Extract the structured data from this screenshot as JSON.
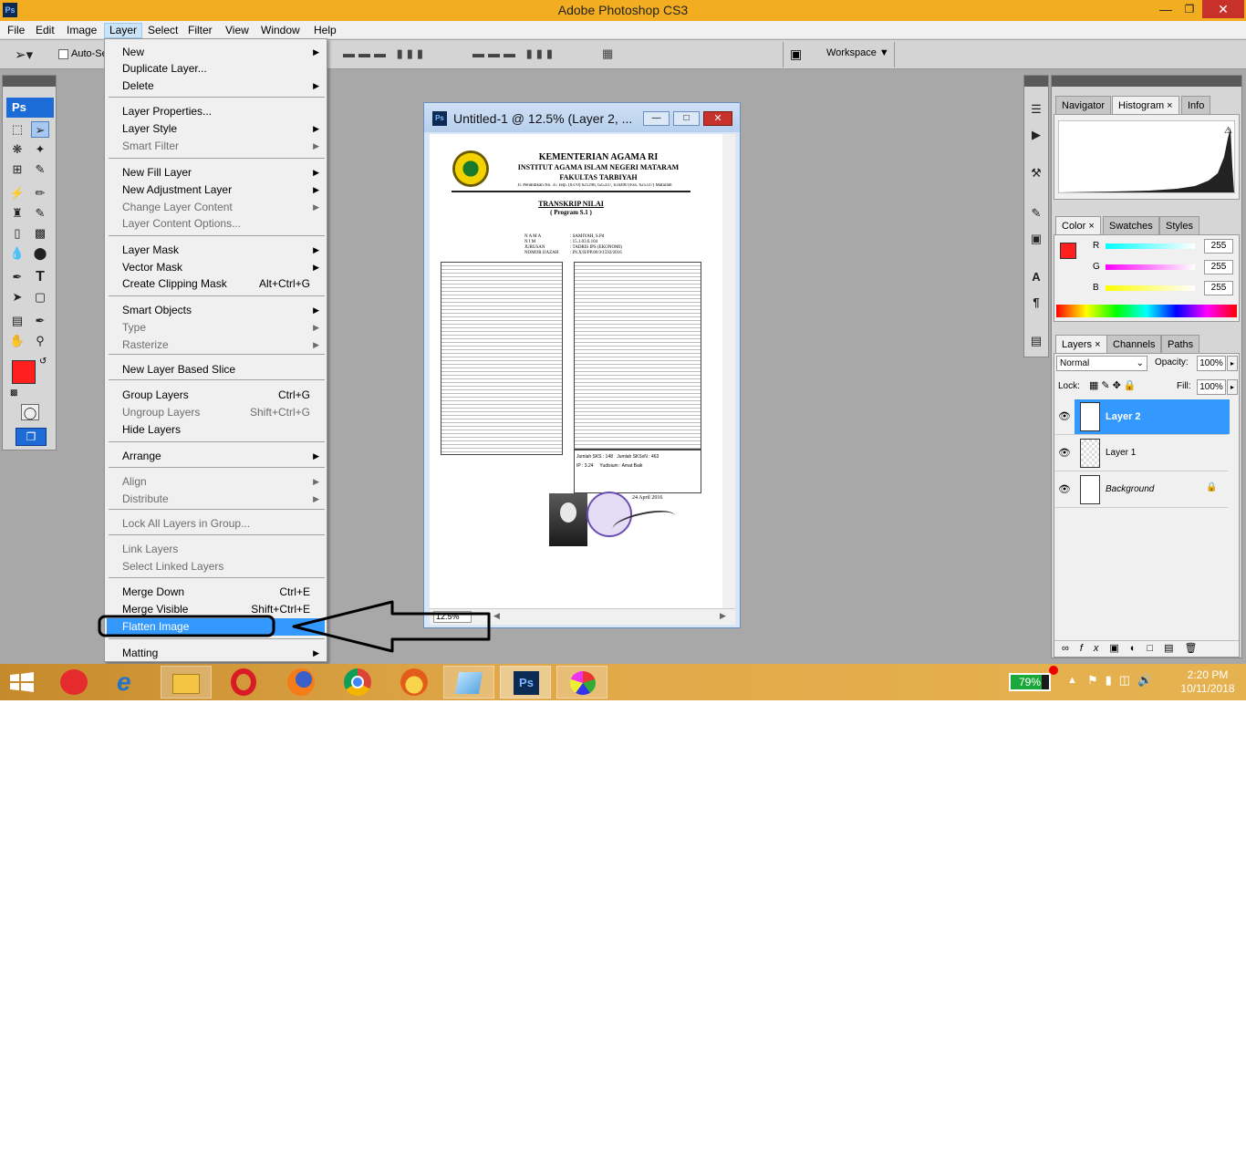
{
  "app": {
    "title": "Adobe Photoshop CS3"
  },
  "menubar": [
    "File",
    "Edit",
    "Image",
    "Layer",
    "Select",
    "Filter",
    "View",
    "Window",
    "Help"
  ],
  "options": {
    "auto_select": "Auto-Se",
    "workspace": "Workspace"
  },
  "layer_menu": [
    {
      "label": "New",
      "arrow": true
    },
    {
      "label": "Duplicate Layer..."
    },
    {
      "label": "Delete",
      "arrow": true
    },
    {
      "sep": true
    },
    {
      "label": "Layer Properties..."
    },
    {
      "label": "Layer Style",
      "arrow": true
    },
    {
      "label": "Smart Filter",
      "arrow": true,
      "disabled": true
    },
    {
      "sep": true
    },
    {
      "label": "New Fill Layer",
      "arrow": true
    },
    {
      "label": "New Adjustment Layer",
      "arrow": true
    },
    {
      "label": "Change Layer Content",
      "arrow": true,
      "disabled": true
    },
    {
      "label": "Layer Content Options...",
      "disabled": true
    },
    {
      "sep": true
    },
    {
      "label": "Layer Mask",
      "arrow": true
    },
    {
      "label": "Vector Mask",
      "arrow": true
    },
    {
      "label": "Create Clipping Mask",
      "shortcut": "Alt+Ctrl+G"
    },
    {
      "sep": true
    },
    {
      "label": "Smart Objects",
      "arrow": true
    },
    {
      "label": "Type",
      "arrow": true,
      "disabled": true
    },
    {
      "label": "Rasterize",
      "arrow": true,
      "disabled": true
    },
    {
      "sep": true
    },
    {
      "label": "New Layer Based Slice"
    },
    {
      "sep": true
    },
    {
      "label": "Group Layers",
      "shortcut": "Ctrl+G"
    },
    {
      "label": "Ungroup Layers",
      "shortcut": "Shift+Ctrl+G",
      "disabled": true
    },
    {
      "label": "Hide Layers"
    },
    {
      "sep": true
    },
    {
      "label": "Arrange",
      "arrow": true
    },
    {
      "sep": true
    },
    {
      "label": "Align",
      "arrow": true,
      "disabled": true
    },
    {
      "label": "Distribute",
      "arrow": true,
      "disabled": true
    },
    {
      "sep": true
    },
    {
      "label": "Lock All Layers in Group...",
      "disabled": true
    },
    {
      "sep": true
    },
    {
      "label": "Link Layers",
      "disabled": true
    },
    {
      "label": "Select Linked Layers",
      "disabled": true
    },
    {
      "sep": true
    },
    {
      "label": "Merge Down",
      "shortcut": "Ctrl+E"
    },
    {
      "label": "Merge Visible",
      "shortcut": "Shift+Ctrl+E"
    },
    {
      "label": "Flatten Image",
      "highlighted": true
    },
    {
      "sep": true
    },
    {
      "label": "Matting",
      "arrow": true
    }
  ],
  "document": {
    "title": "Untitled-1 @ 12.5% (Layer 2, ...",
    "zoom": "12.5%",
    "letterhead": [
      "KEMENTERIAN AGAMA RI",
      "INSTITUT AGAMA ISLAM NEGERI MATARAM",
      "FAKULTAS TARBIYAH"
    ],
    "address": "Jl. Pendidikan No. 35 Telp. (0370) 621298, 625337, 634490 (Fax. 625337) Mataram",
    "heading": "TRANSKRIP NILAI",
    "subheading": "( Program S.1 )",
    "bio_labels": [
      "N A M A",
      "N I M",
      "JURUSAN",
      "NOMOR IJAZAH"
    ],
    "bio_values": [
      ": SAMIYAH, S.Pd",
      ": 15.1.03.6.104",
      ": TADRIS IPS (EKONOMI)",
      ": IN.X/II/PP.00.9/1592/2016"
    ],
    "summary": [
      "Jumlah SKS : 148",
      "Jumlah SKSxN : 463",
      "IP : 3.24",
      "Yudisium : Amat Baik"
    ],
    "date_line": "24 April 2016"
  },
  "panels": {
    "top_tabs": [
      "Navigator",
      "Histogram",
      "Info"
    ],
    "color_tabs": [
      "Color",
      "Swatches",
      "Styles"
    ],
    "color": {
      "r_label": "R",
      "g_label": "G",
      "b_label": "B",
      "r": "255",
      "g": "255",
      "b": "255",
      "fg": "#ff1f1f"
    },
    "layer_tabs": [
      "Layers",
      "Channels",
      "Paths"
    ],
    "blend_mode": "Normal",
    "opacity_label": "Opacity:",
    "opacity": "100%",
    "lock_label": "Lock:",
    "fill_label": "Fill:",
    "fill": "100%",
    "layers": [
      {
        "name": "Layer 2",
        "selected": true
      },
      {
        "name": "Layer 1"
      },
      {
        "name": "Background",
        "italic": true,
        "locked": true
      }
    ]
  },
  "taskbar": {
    "battery": "79%",
    "time": "2:20 PM",
    "date": "10/11/2018"
  },
  "colors": {
    "taskbar": "#e0a848",
    "titlebar": "#f2ae20",
    "highlight": "#3399ff",
    "annotation": "#000000"
  }
}
